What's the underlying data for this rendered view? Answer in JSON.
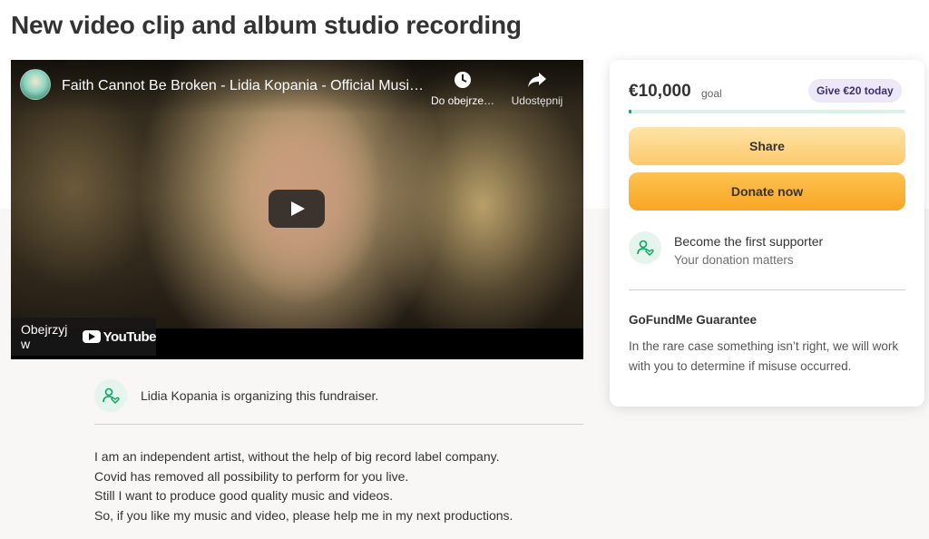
{
  "page": {
    "title": "New video clip and album studio recording"
  },
  "video": {
    "title": "Faith Cannot Be Broken - Lidia Kopania - Official Musi…",
    "watch_later_label": "Do obejrze…",
    "share_label": "Udostępnij",
    "watch_on_label": "Obejrzyj w",
    "youtube_word": "YouTube"
  },
  "organizer": {
    "text": "Lidia Kopania is organizing this fundraiser."
  },
  "story": {
    "lines": [
      "I am an independent artist, without the help of big record label company.",
      "Covid has removed all possibility to perform for you live.",
      "Still I want to produce good quality music and videos.",
      "So, if you like my music and video, please help me in my next productions."
    ]
  },
  "donate_card": {
    "amount": "€10,000",
    "goal_label": "goal",
    "give_badge": "Give €20 today",
    "progress_fraction": 0.01,
    "share_button": "Share",
    "donate_button": "Donate now",
    "supporter_title": "Become the first supporter",
    "supporter_subtitle": "Your donation matters",
    "guarantee_title": "GoFundMe Guarantee",
    "guarantee_text": "In the rare case something isn’t right, we will work with you to determine if misuse occurred."
  },
  "colors": {
    "accent_green": "#02a95c",
    "donate_orange": "#f8a524",
    "share_yellow": "#fcc96a"
  }
}
